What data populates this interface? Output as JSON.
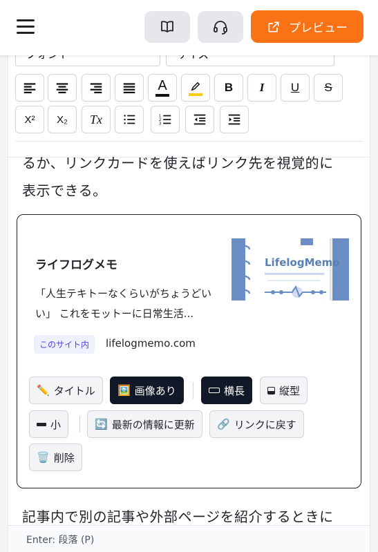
{
  "header": {
    "preview_label": "プレビュー"
  },
  "toolbar": {
    "font_select": "フォント",
    "size_select": "サイズ",
    "text_color_glyph": "A",
    "bold": "B",
    "italic": "I",
    "underline": "U",
    "strike": "S",
    "superscript": "X²",
    "subscript": "X₂",
    "clear_format": "Tx"
  },
  "content": {
    "para_top": "るか、リンクカードを使えばリンク先を視覚的に",
    "para_top_2": "表示できる。",
    "para_bottom": "記事内で別の記事や外部ページを紹介するときに"
  },
  "link_card": {
    "title": "ライフログメモ",
    "description": "「人生テキトーなくらいがちょうどいい」 これをモットーに日常生活...",
    "badge": "このサイト内",
    "domain": "lifelogmemo.com",
    "thumbnail_text": "LifelogMemo"
  },
  "card_controls": {
    "title_btn": "タイトル",
    "image_btn": "画像あり",
    "landscape_btn": "横長",
    "portrait_btn": "縦型",
    "small_btn": "小",
    "refresh_btn": "最新の情報に更新",
    "unlink_btn": "リンクに戻す",
    "delete_btn": "削除"
  },
  "status": {
    "hint": "Enter: 段落 (P)"
  },
  "colors": {
    "accent": "#f97316",
    "dark_button": "#111827",
    "badge_text": "#4f46e5",
    "thumbnail_blue": "#6b8fc4"
  }
}
